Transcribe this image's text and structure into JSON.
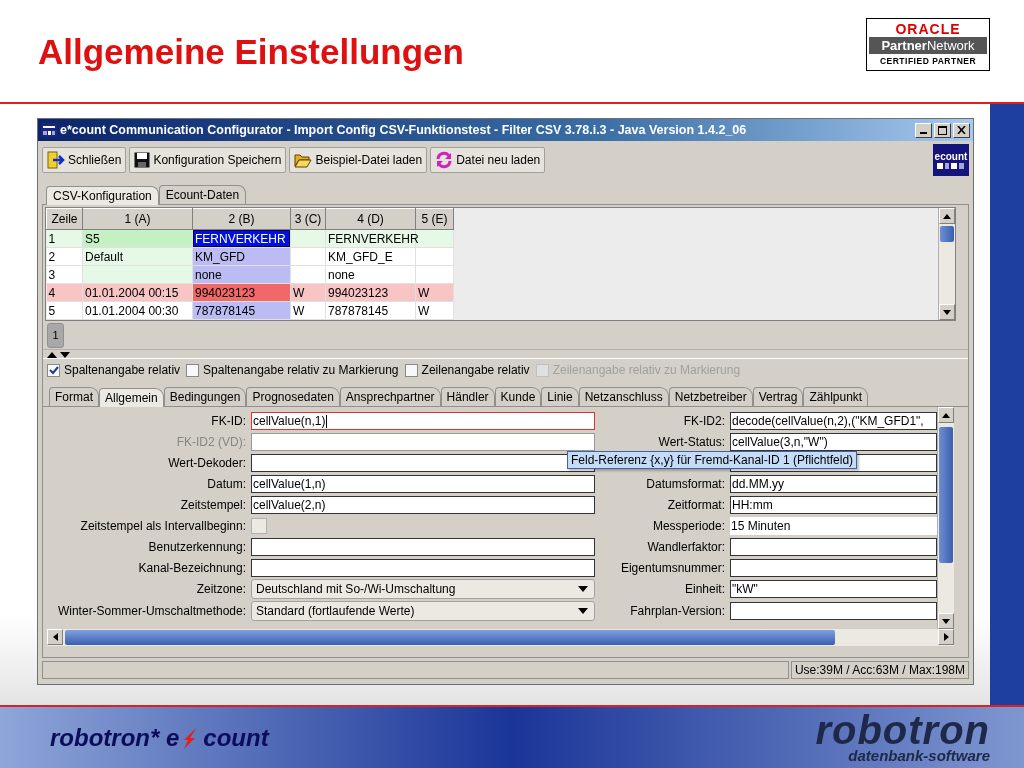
{
  "slide": {
    "title": "Allgemeine Einstellungen"
  },
  "partner_logo": {
    "brand": "ORACLE",
    "program": "**Partner**Network",
    "badge": "CERTIFIED PARTNER"
  },
  "window": {
    "title": "e*count Communication Configurator - Import Config CSV-Funktionstest - Filter CSV 3.78.i.3 - Java Version 1.4.2_06"
  },
  "toolbar": {
    "buttons": [
      {
        "label": "Schließen",
        "kind": "exit"
      },
      {
        "label": "Konfiguration Speichern",
        "kind": "save"
      },
      {
        "label": "Beispiel-Datei laden",
        "kind": "open"
      },
      {
        "label": "Datei neu laden",
        "kind": "reload"
      }
    ],
    "logo": "ecount"
  },
  "tabs": [
    {
      "label": "CSV-Konfiguration",
      "selected": true
    },
    {
      "label": "Ecount-Daten",
      "selected": false
    }
  ],
  "table": {
    "columns": [
      "Zeile",
      "1 (A)",
      "2 (B)",
      "3 (C)",
      "4 (D)",
      "5 (E)"
    ],
    "rows": [
      {
        "cells": [
          {
            "text": "1",
            "color": "#e6f8e6",
            "selected": false
          },
          {
            "text": "S5",
            "color": "#c4f0c4",
            "selected": false
          },
          {
            "text": "FERNVERKEHR",
            "color": "#0010e0",
            "selected": true
          },
          {
            "color": "#e6f8e6",
            "selected": false
          },
          {
            "text": "FERNVERKEHR",
            "color": "#e6f8e6",
            "selected": false
          },
          {
            "color": "#e6f8e6",
            "selected": false
          }
        ]
      },
      {
        "cells": [
          {
            "text": "2",
            "color": "#ffffff",
            "selected": false
          },
          {
            "text": "Default",
            "color": "#e6f8e6",
            "selected": false
          },
          {
            "text": "KM_GFD",
            "color": "#bcbcf4",
            "selected": false
          },
          {
            "color": "#ffffff",
            "selected": false
          },
          {
            "text": "KM_GFD_E",
            "color": "#ffffff",
            "selected": false
          },
          {
            "color": "#ffffff",
            "selected": false
          }
        ]
      },
      {
        "cells": [
          {
            "text": "3",
            "color": "#ffffff",
            "selected": false
          },
          {
            "color": "#e6f8e6",
            "selected": false
          },
          {
            "text": "none",
            "color": "#bcbcf4",
            "selected": false
          },
          {
            "color": "#ffffff",
            "selected": false
          },
          {
            "text": "none",
            "color": "#ffffff",
            "selected": false
          },
          {
            "color": "#ffffff",
            "selected": false
          }
        ]
      },
      {
        "cells": [
          {
            "text": "4",
            "color": "#f8c4c4",
            "selected": false
          },
          {
            "text": "01.01.2004 00:15",
            "color": "#f8c4c4",
            "selected": false
          },
          {
            "text": "994023123",
            "color": "#f06868",
            "selected": false
          },
          {
            "text": "W",
            "color": "#f8c4c4",
            "selected": false
          },
          {
            "text": "994023123",
            "color": "#f8c4c4",
            "selected": false
          },
          {
            "text": "W",
            "color": "#f8c4c4",
            "selected": false
          }
        ]
      },
      {
        "cells": [
          {
            "text": "5",
            "color": "#ffffff",
            "selected": false
          },
          {
            "text": "01.01.2004 00:30",
            "color": "#ffffff",
            "selected": false
          },
          {
            "text": "787878145",
            "color": "#bcbcf4",
            "selected": false
          },
          {
            "text": "W",
            "color": "#ffffff",
            "selected": false
          },
          {
            "text": "787878145",
            "color": "#ffffff",
            "selected": false
          },
          {
            "text": "W",
            "color": "#ffffff",
            "selected": false
          }
        ]
      }
    ]
  },
  "pager": {
    "pages": [
      {
        "label": "1",
        "selected": true
      }
    ]
  },
  "options": [
    {
      "label": "Spaltenangabe relativ",
      "checked": true,
      "disabled": false
    },
    {
      "label": "Spaltenangabe relativ zu Markierung",
      "checked": false,
      "disabled": false
    },
    {
      "label": "Zeilenangabe relativ",
      "checked": false,
      "disabled": false
    },
    {
      "label": "Zeilenangabe relativ zu Markierung",
      "checked": false,
      "disabled": true
    }
  ],
  "subtabs": [
    {
      "label": "Format",
      "selected": false
    },
    {
      "label": "Allgemein",
      "selected": true
    },
    {
      "label": "Bedingungen",
      "selected": false
    },
    {
      "label": "Prognosedaten",
      "selected": false
    },
    {
      "label": "Ansprechpartner",
      "selected": false
    },
    {
      "label": "Händler",
      "selected": false
    },
    {
      "label": "Kunde",
      "selected": false
    },
    {
      "label": "Linie",
      "selected": false
    },
    {
      "label": "Netzanschluss",
      "selected": false
    },
    {
      "label": "Netzbetreiber",
      "selected": false
    },
    {
      "label": "Vertrag",
      "selected": false
    },
    {
      "label": "Zählpunkt",
      "selected": false
    }
  ],
  "form": {
    "left": [
      {
        "kind": "field",
        "label": "FK-ID:",
        "value": "cellValue(n,1)",
        "focused": true,
        "disabled": false
      },
      {
        "kind": "field",
        "label": "FK-ID2 (VD):",
        "focused": false,
        "disabled": true
      },
      {
        "kind": "field",
        "label": "Wert-Dekoder:",
        "focused": false,
        "disabled": false
      },
      {
        "kind": "field",
        "label": "Datum:",
        "value": "cellValue(1,n)",
        "focused": false,
        "disabled": false
      },
      {
        "kind": "field",
        "label": "Zeitstempel:",
        "value": "cellValue(2,n)",
        "focused": false,
        "disabled": false
      },
      {
        "kind": "checkbox",
        "label": "Zeitstempel als Intervallbeginn:",
        "checked": false
      },
      {
        "kind": "field",
        "label": "Benutzerkennung:",
        "focused": false,
        "disabled": false
      },
      {
        "kind": "field",
        "label": "Kanal-Bezeichnung:",
        "focused": false,
        "disabled": false
      },
      {
        "kind": "dropdown",
        "label": "Zeitzone:",
        "value": "Deutschland mit So-/Wi-Umschaltung"
      },
      {
        "kind": "dropdown",
        "label": "Winter-Sommer-Umschaltmethode:",
        "value": "Standard (fortlaufende Werte)"
      }
    ],
    "right": [
      {
        "kind": "field",
        "label": "FK-ID2:",
        "value": "decode(cellValue(n,2),(\"KM_GFD1\",",
        "focused": false,
        "disabled": false
      },
      {
        "kind": "field",
        "label": "Wert-Status:",
        "value": "cellValue(3,n,\"W\")",
        "focused": false,
        "disabled": false
      },
      {
        "kind": "field",
        "focused": false,
        "disabled": false
      },
      {
        "kind": "field",
        "label": "Datumsformat:",
        "value": "dd.MM.yy",
        "focused": false,
        "disabled": false
      },
      {
        "kind": "field",
        "label": "Zeitformat:",
        "value": "HH:mm",
        "focused": false,
        "disabled": false
      },
      {
        "kind": "readonly",
        "label": "Messperiode:",
        "value": "15 Minuten"
      },
      {
        "kind": "field",
        "label": "Wandlerfaktor:",
        "focused": false,
        "disabled": false
      },
      {
        "kind": "field",
        "label": "Eigentumsnummer:",
        "focused": false,
        "disabled": false
      },
      {
        "kind": "field",
        "label": "Einheit:",
        "value": "\"kW\"",
        "focused": false,
        "disabled": false
      },
      {
        "kind": "field",
        "label": "Fahrplan-Version:",
        "focused": false,
        "disabled": false
      }
    ],
    "tooltip": "Feld-Referenz {x,y} für Fremd-Kanal-ID 1 (Pflichtfeld)"
  },
  "status_bar": {
    "memory": "Use:39M / Acc:63M / Max:198M"
  },
  "footer": {
    "product_before": "robotron* e",
    "product_after": "count",
    "company": "robotron",
    "company_tagline": "datenbank-software"
  }
}
